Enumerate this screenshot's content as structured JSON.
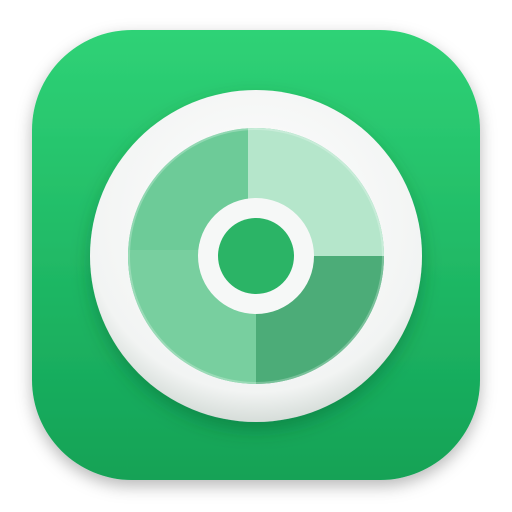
{
  "icon": {
    "name": "disc-icon",
    "colors": {
      "tile_top": "#2fd276",
      "tile_bottom": "#12a256",
      "rim": "#f2f4f3",
      "rim_shadow": "#d6ddd9",
      "disc_base": "#5fc590",
      "quadrant_light": "#b5e6cb",
      "quadrant_mid": "#78cf9f",
      "quadrant_dark": "#4cac78",
      "hub_ring": "#f6f8f7",
      "hub_center": "#2bb466"
    }
  }
}
